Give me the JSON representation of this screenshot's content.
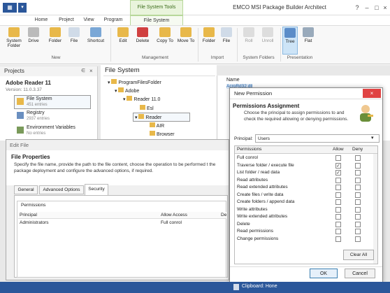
{
  "app_title": "EMCO MSI Package Builder Architect",
  "context_group": "File System Tools",
  "tabs": [
    "Home",
    "Project",
    "View",
    "Program",
    "File System"
  ],
  "ribbon": {
    "new_group": "New",
    "new_buttons": [
      "System Folder",
      "Drive",
      "Folder",
      "File",
      "Shortcut"
    ],
    "mgmt_group": "Management",
    "mgmt_buttons": [
      "Edit",
      "Delete",
      "Copy To",
      "Move To"
    ],
    "import_group": "Import",
    "import_buttons": [
      "Folder",
      "File"
    ],
    "sysfolders_group": "System Folders",
    "sysfolders_buttons": [
      "Roll",
      "Unroll"
    ],
    "presentation_group": "Presentation",
    "presentation_buttons": [
      "Tree",
      "Flat"
    ]
  },
  "projects": {
    "title": "Projects",
    "pin": "∈",
    "close": "×",
    "product": "Adobe Reader 11",
    "version": "Version: 11.0.3.37",
    "items": [
      {
        "label": "File System",
        "sub": "451 entries"
      },
      {
        "label": "Registry",
        "sub": "2937 entries"
      },
      {
        "label": "Environment Variables",
        "sub": "No entries"
      }
    ]
  },
  "filesystem": {
    "title": "File System",
    "tree": [
      "ProgramFilesFolder",
      "Adobe",
      "Reader 11.0",
      "Esl",
      "Reader",
      "AIR",
      "Browser"
    ]
  },
  "list": {
    "header": "Name",
    "first_row": "AcroRd32.dll"
  },
  "editfile": {
    "title": "Edit File",
    "heading": "File Properties",
    "description": "Specify the file name, provide the path to the file content, choose the operation to be performed t the package deployment and configure the advanced options, if required.",
    "tabs": [
      "General",
      "Advanced Options",
      "Security"
    ],
    "perm_label": "Permissions",
    "columns": [
      "Principal",
      "Allow Access",
      "De"
    ],
    "row": {
      "principal": "Administrators",
      "access": "Full conrol"
    }
  },
  "dialog": {
    "title": "New Permission",
    "heading": "Permissions Assignment",
    "description": "Choose the principal to assign permissions to and check the required allowing or denying permissions.",
    "principal_label": "Principal:",
    "principal_value": "Users",
    "columns": [
      "Permissions",
      "Allow",
      "Deny"
    ],
    "permissions": [
      {
        "name": "Full conrol",
        "allow": false,
        "deny": false
      },
      {
        "name": "Traverse folder / execute file",
        "allow": true,
        "deny": false
      },
      {
        "name": "List folder / read data",
        "allow": true,
        "deny": false
      },
      {
        "name": "Read attributes",
        "allow": false,
        "deny": false
      },
      {
        "name": "Read extended attributes",
        "allow": false,
        "deny": false
      },
      {
        "name": "Create files / write data",
        "allow": false,
        "deny": false
      },
      {
        "name": "Create folders / append data",
        "allow": false,
        "deny": false
      },
      {
        "name": "Write attributes",
        "allow": false,
        "deny": false
      },
      {
        "name": "Write extended attributes",
        "allow": false,
        "deny": false
      },
      {
        "name": "Delete",
        "allow": false,
        "deny": false
      },
      {
        "name": "Read permissions",
        "allow": false,
        "deny": false
      },
      {
        "name": "Change permissions",
        "allow": false,
        "deny": false
      }
    ],
    "clear_all": "Clear All",
    "ok": "OK",
    "cancel": "Cancel"
  },
  "status": {
    "clipboard": "Clipboard: Hone"
  },
  "colors": {
    "accent": "#2b579a",
    "close_red": "#e04343",
    "context_green": "#b7d79a"
  }
}
